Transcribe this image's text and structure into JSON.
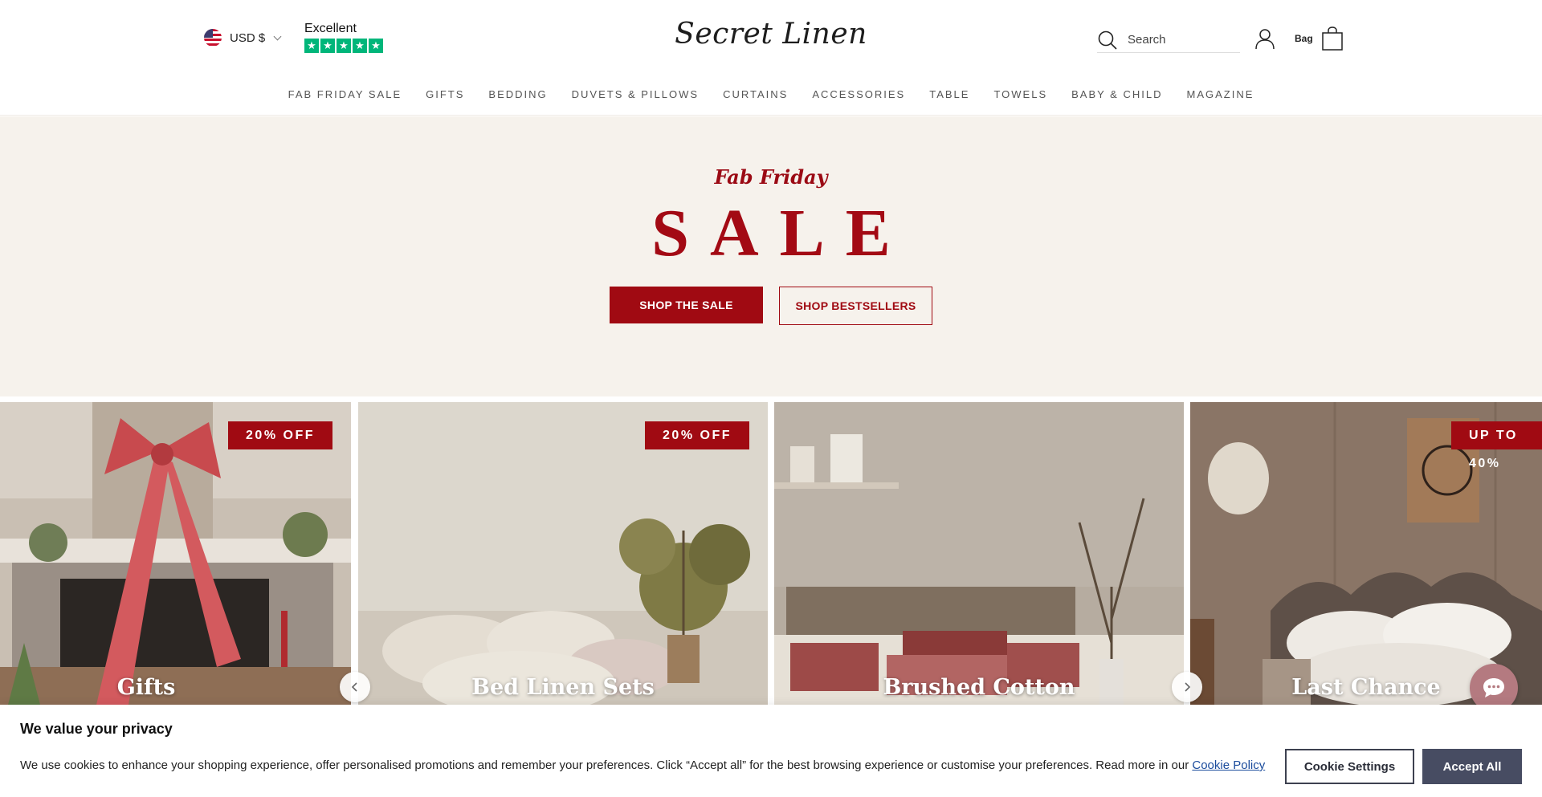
{
  "header": {
    "currency": "USD $",
    "trustpilot_label": "Excellent",
    "logo": "Secret Linen",
    "search_placeholder": "Search",
    "bag_label": "Bag"
  },
  "nav": {
    "items": [
      "FAB FRIDAY SALE",
      "GIFTS",
      "BEDDING",
      "DUVETS & PILLOWS",
      "CURTAINS",
      "ACCESSORIES",
      "TABLE",
      "TOWELS",
      "BABY & CHILD",
      "MAGAZINE"
    ]
  },
  "hero": {
    "subtitle": "Fab Friday",
    "title": "SALE",
    "primary_button": "SHOP THE SALE",
    "secondary_button": "SHOP BESTSELLERS"
  },
  "categories": [
    {
      "title": "Gifts",
      "badge": "20% OFF"
    },
    {
      "title": "Bed Linen Sets",
      "badge": "20% OFF"
    },
    {
      "title": "Brushed Cotton",
      "badge": ""
    },
    {
      "title": "Last Chance",
      "badge": "UP TO 40%"
    }
  ],
  "cookie": {
    "title": "We value your privacy",
    "text": "We use cookies to enhance your shopping experience, offer personalised promotions and remember your preferences. Click “Accept all” for the best browsing experience or customise your preferences. Read more in our",
    "link": "Cookie Policy",
    "settings_button": "Cookie Settings",
    "accept_button": "Accept All"
  },
  "colors": {
    "brand_red": "#a00a12",
    "hero_bg": "#f6f2ec",
    "trustpilot_green": "#00b67a",
    "cookie_accept": "#474c62",
    "chat_button": "#b47a80"
  },
  "icons": [
    "us-flag-icon",
    "chevron-down-icon",
    "trustpilot-star-icon",
    "search-icon",
    "account-icon",
    "shopping-bag-icon",
    "chevron-left-icon",
    "chevron-right-icon",
    "chat-icon"
  ]
}
